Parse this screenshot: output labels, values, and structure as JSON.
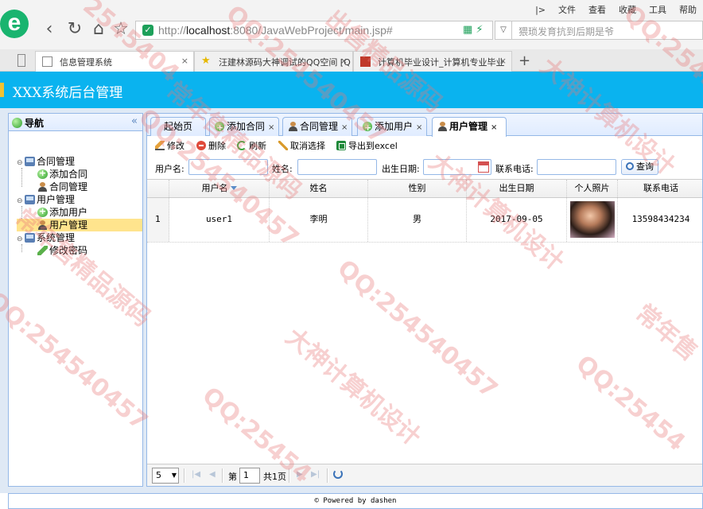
{
  "browser": {
    "url_prefix": "http://",
    "url_host": "localhost",
    "url_rest": ":8080/JavaWebProject/main.jsp#",
    "search_placeholder": "猥琐发育抗到后期是爷",
    "menu": [
      "|>",
      "文件",
      "查看",
      "收藏",
      "工具",
      "帮助"
    ],
    "tabs": [
      {
        "label": "信息管理系统"
      },
      {
        "label": "汪建林源码大神调试的QQ空间 [Q"
      },
      {
        "label": "计算机毕业设计_计算机专业毕业"
      }
    ]
  },
  "app": {
    "title": "XXX系统后台管理"
  },
  "west": {
    "title": "导航",
    "collapse": "«",
    "tree": {
      "group1": {
        "label": "合同管理",
        "items": [
          "添加合同",
          "合同管理"
        ]
      },
      "group2": {
        "label": "用户管理",
        "items": [
          "添加用户",
          "用户管理"
        ]
      },
      "group3": {
        "label": "系统管理",
        "items": [
          "修改密码"
        ]
      }
    }
  },
  "center": {
    "tabs": [
      {
        "label": "起始页"
      },
      {
        "label": "添加合同"
      },
      {
        "label": "合同管理"
      },
      {
        "label": "添加用户"
      },
      {
        "label": "用户管理"
      }
    ],
    "toolbar": {
      "edit": "修改",
      "delete": "删除",
      "refresh": "刷新",
      "cancel_select": "取消选择",
      "export": "导出到excel"
    },
    "search": {
      "username_label": "用户名:",
      "name_label": "姓名:",
      "birth_label": "出生日期:",
      "phone_label": "联系电话:",
      "query_button": "查询"
    },
    "grid": {
      "columns": [
        "用户名",
        "姓名",
        "性别",
        "出生日期",
        "个人照片",
        "联系电话"
      ],
      "rows": [
        {
          "rownum": "1",
          "username": "user1",
          "name": "李明",
          "gender": "男",
          "birth": "2017-09-05",
          "phone": "13598434234"
        }
      ]
    },
    "pager": {
      "page_size": "5",
      "page_label": "第",
      "page_value": "1",
      "total_label": "共1页"
    }
  },
  "footer": {
    "text": "© Powered by dashen"
  },
  "watermarks": {
    "qq": "QQ:2545404",
    "qq_b": "QQ:254540457",
    "qq_c": "QQ:25454",
    "qq_d": "2545404",
    "a": "大神计算机设计",
    "b": "常年售精品源码",
    "c": "常年售精品源码",
    "d": "大神计算机设计",
    "e": "出售精品源码",
    "f": "QQ:254540457",
    "g": "QQ:254540457",
    "h": "大神计算机设计",
    "i": "常年售"
  },
  "colors": {
    "header_bg": "#0ab3ef",
    "panel_border": "#95b8e7",
    "selected_node": "#ffe48d"
  }
}
